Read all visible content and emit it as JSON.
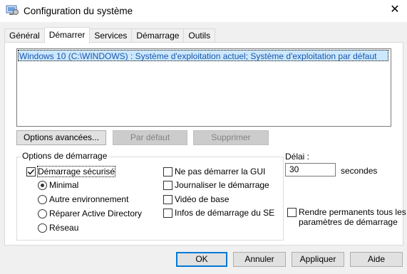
{
  "window": {
    "title": "Configuration du système",
    "close_glyph": "✕",
    "app_icon": "system-config-icon"
  },
  "tabs": [
    {
      "label": "Général",
      "active": false
    },
    {
      "label": "Démarrer",
      "active": true
    },
    {
      "label": "Services",
      "active": false
    },
    {
      "label": "Démarrage",
      "active": false
    },
    {
      "label": "Outils",
      "active": false
    }
  ],
  "boot_list": {
    "items": [
      "Windows 10 (C:\\WINDOWS) : Système d'exploitation actuel; Système d'exploitation par défaut"
    ]
  },
  "list_buttons": {
    "advanced": "Options avancées...",
    "default": "Par défaut",
    "delete": "Supprimer"
  },
  "boot_options": {
    "group_title": "Options de démarrage",
    "safe_boot": {
      "label": "Démarrage sécurisé",
      "checked": true
    },
    "radios": [
      {
        "label": "Minimal",
        "selected": true
      },
      {
        "label": "Autre environnement",
        "selected": false
      },
      {
        "label": "Réparer Active Directory",
        "selected": false
      },
      {
        "label": "Réseau",
        "selected": false
      }
    ],
    "checkboxes": [
      {
        "label": "Ne pas démarrer la GUI",
        "checked": false
      },
      {
        "label": "Journaliser le démarrage",
        "checked": false
      },
      {
        "label": "Vidéo de base",
        "checked": false
      },
      {
        "label": "Infos de démarrage du SE",
        "checked": false
      }
    ]
  },
  "timeout": {
    "label": "Délai :",
    "value": "30",
    "unit": "secondes"
  },
  "permanent": {
    "line1": "Rendre permanents tous les",
    "line2": "paramètres de démarrage",
    "checked": false
  },
  "footer": {
    "ok": "OK",
    "cancel": "Annuler",
    "apply": "Appliquer",
    "help": "Aide"
  },
  "colors": {
    "accent": "#0078d7",
    "selection_bg": "#cce8ff",
    "selection_text": "#1a56a8"
  }
}
